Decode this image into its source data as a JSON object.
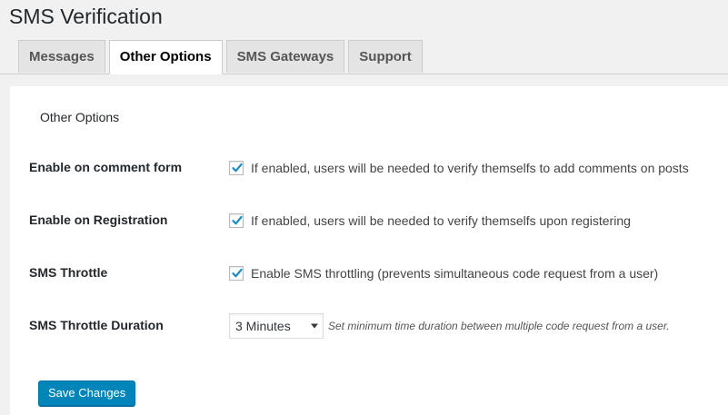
{
  "page": {
    "title": "SMS Verification"
  },
  "tabs": [
    {
      "label": "Messages",
      "active": false
    },
    {
      "label": "Other Options",
      "active": true
    },
    {
      "label": "SMS Gateways",
      "active": false
    },
    {
      "label": "Support",
      "active": false
    }
  ],
  "section": {
    "title": "Other Options"
  },
  "settings": {
    "comment_form": {
      "label": "Enable on comment form",
      "checked": true,
      "description": "If enabled, users will be needed to verify themselfs to add comments on posts"
    },
    "registration": {
      "label": "Enable on Registration",
      "checked": true,
      "description": "If enabled, users will be needed to verify themselfs upon registering"
    },
    "throttle": {
      "label": "SMS Throttle",
      "checked": true,
      "description": "Enable SMS throttling (prevents simultaneous code request from a user)"
    },
    "throttle_duration": {
      "label": "SMS Throttle Duration",
      "selected": "3 Minutes",
      "description": "Set minimum time duration between multiple code request from a user."
    }
  },
  "actions": {
    "save_label": "Save Changes"
  },
  "icons": {
    "checkmark": "checkmark-icon",
    "select_caret": "caret-down-icon"
  },
  "colors": {
    "accent": "#0085ba",
    "checkmark": "#1e8cbe",
    "background": "#f1f1f1",
    "panel": "#ffffff"
  }
}
